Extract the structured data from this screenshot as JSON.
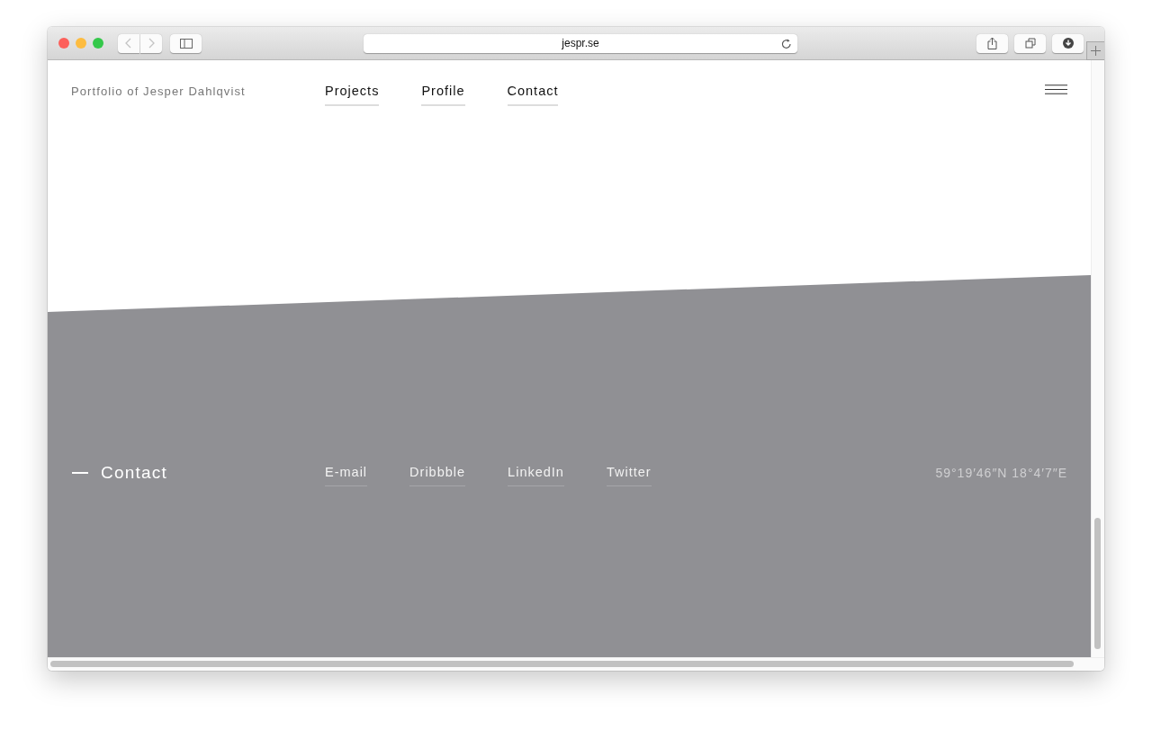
{
  "browser": {
    "url": "jespr.se"
  },
  "header": {
    "brand": "Portfolio of Jesper Dahlqvist",
    "nav": [
      {
        "label": "Projects"
      },
      {
        "label": "Profile"
      },
      {
        "label": "Contact"
      }
    ]
  },
  "footer": {
    "heading": "Contact",
    "links": [
      {
        "label": "E-mail"
      },
      {
        "label": "Dribbble"
      },
      {
        "label": "LinkedIn"
      },
      {
        "label": "Twitter"
      }
    ],
    "coordinates": "59°19′46″N 18°4′7″E"
  }
}
